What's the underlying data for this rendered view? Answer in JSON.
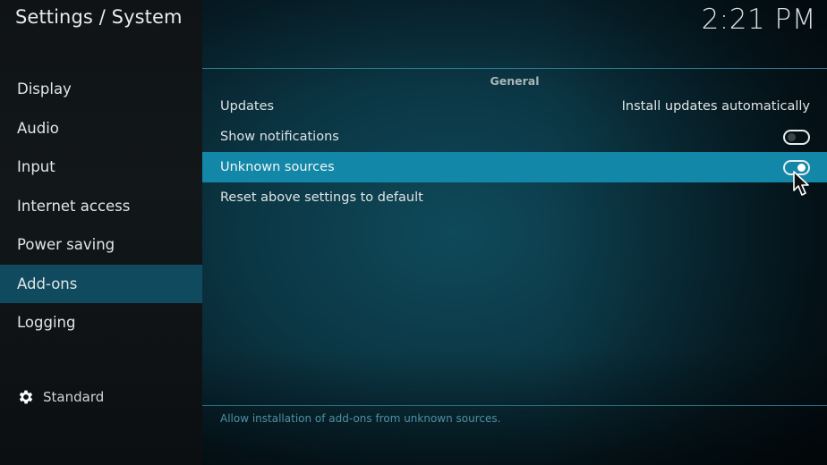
{
  "header": {
    "title": "Settings / System",
    "clock": "2:21 PM"
  },
  "sidebar": {
    "items": [
      {
        "label": "Display",
        "active": false
      },
      {
        "label": "Audio",
        "active": false
      },
      {
        "label": "Input",
        "active": false
      },
      {
        "label": "Internet access",
        "active": false
      },
      {
        "label": "Power saving",
        "active": false
      },
      {
        "label": "Add-ons",
        "active": true
      },
      {
        "label": "Logging",
        "active": false
      }
    ],
    "settings_level": {
      "icon": "gear-icon",
      "label": "Standard"
    }
  },
  "main": {
    "section_title": "General",
    "rows": [
      {
        "label": "Updates",
        "value": "Install updates automatically"
      },
      {
        "label": "Show notifications",
        "toggle": "off"
      },
      {
        "label": "Unknown sources",
        "toggle": "on",
        "selected": true
      },
      {
        "label": "Reset above settings to default"
      }
    ],
    "help_text": "Allow installation of add-ons from unknown sources."
  },
  "colors": {
    "accent_selected": "#1287a8",
    "sidebar_active": "#0f4a5e"
  }
}
